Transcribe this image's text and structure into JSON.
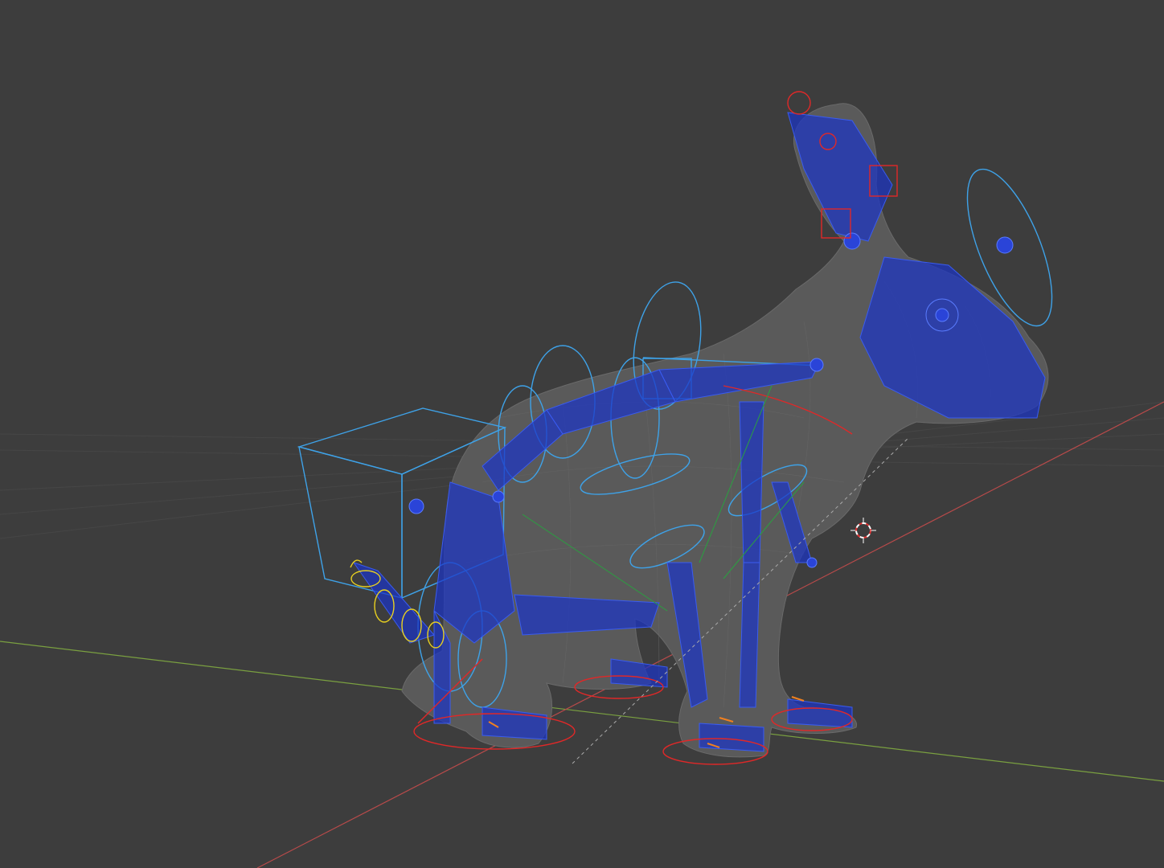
{
  "viewport": {
    "name": "3D Viewport",
    "background": "#3d3d3d",
    "grid_color": "#4a4a4a",
    "x_axis_color": "#b84a4a",
    "y_axis_color": "#7aa040"
  },
  "scene": {
    "object": "rabbit-mesh",
    "armature": "rabbit-rig",
    "mesh_color": "#5c5c5c",
    "bone_color": "#1a33c8",
    "bone_highlight": "#3a5cf0",
    "widget_blue": "#3ea2e8",
    "widget_red": "#e02828",
    "widget_green": "#2aa040",
    "widget_yellow": "#e8d020",
    "widget_orange": "#f08020"
  },
  "cursor": {
    "icon": "3d-cursor-icon"
  }
}
